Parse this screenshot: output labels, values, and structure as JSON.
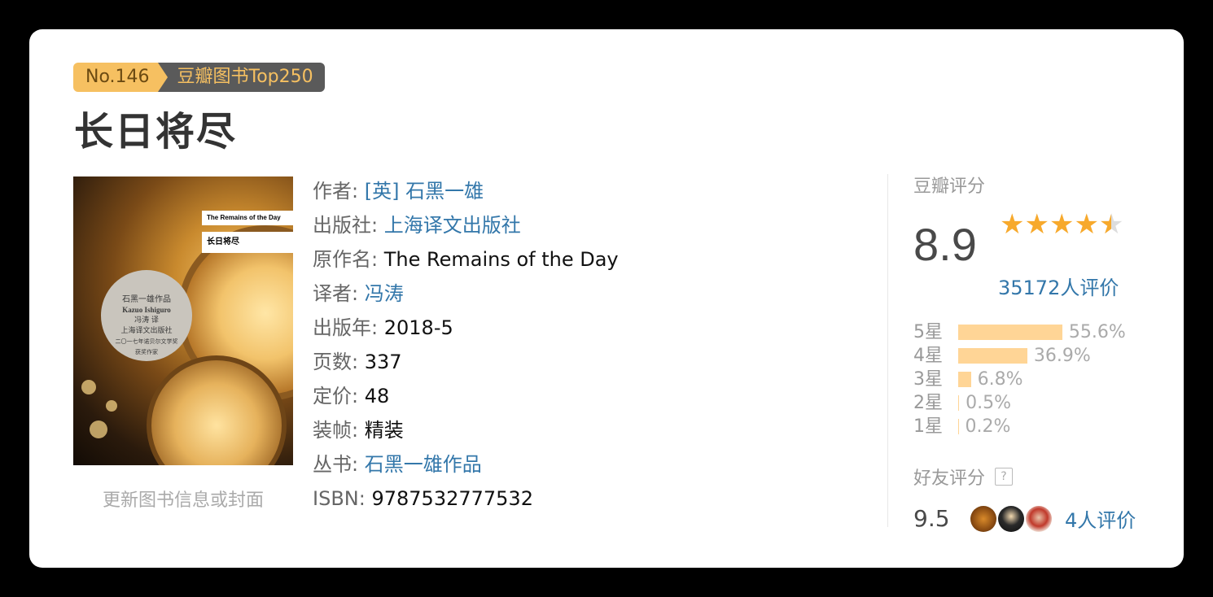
{
  "badge": {
    "rank": "No.146",
    "list": "豆瓣图书Top250"
  },
  "title": "长日将尽",
  "cover": {
    "en_title": "The Remains of the Day",
    "cn_title": "长日将尽",
    "seal_line1": "二〇一七年诺贝尔文学奖",
    "seal_line2": "获奖作家",
    "author_work": "石黑一雄作品",
    "author_en": "Kazuo Ishiguro",
    "translator": "冯涛 译",
    "publisher": "上海译文出版社"
  },
  "update_link": "更新图书信息或封面",
  "info": {
    "author_label": "作者:",
    "author": "[英] 石黑一雄",
    "publisher_label": "出版社:",
    "publisher": "上海译文出版社",
    "original_label": "原作名:",
    "original": "The Remains of the Day",
    "translator_label": "译者:",
    "translator": "冯涛",
    "year_label": "出版年:",
    "year": "2018-5",
    "pages_label": "页数:",
    "pages": "337",
    "price_label": "定价:",
    "price": "48",
    "binding_label": "装帧:",
    "binding": "精装",
    "series_label": "丛书:",
    "series": "石黑一雄作品",
    "isbn_label": "ISBN:",
    "isbn": "9787532777532"
  },
  "rating": {
    "heading": "豆瓣评分",
    "score": "8.9",
    "stars": 4.5,
    "votes": "35172人评价",
    "distribution": [
      {
        "label": "5星",
        "pct": "55.6%",
        "value": 55.6
      },
      {
        "label": "4星",
        "pct": "36.9%",
        "value": 36.9
      },
      {
        "label": "3星",
        "pct": "6.8%",
        "value": 6.8
      },
      {
        "label": "2星",
        "pct": "0.5%",
        "value": 0.5
      },
      {
        "label": "1星",
        "pct": "0.2%",
        "value": 0.2
      }
    ],
    "friend_heading": "好友评分",
    "friend_help": "?",
    "friend_score": "9.5",
    "friend_votes": "4人评价"
  },
  "colors": {
    "link": "#3377aa",
    "star": "#f7a92c",
    "bar": "#ffd596",
    "badge_gold": "#f6c061",
    "badge_dark": "#5a5a5a"
  }
}
